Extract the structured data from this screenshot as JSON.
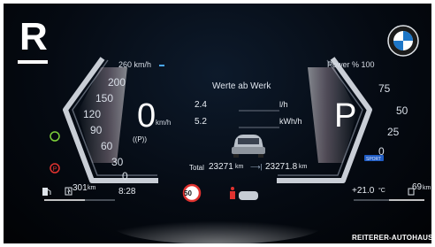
{
  "brand": {
    "logo_letter": "R",
    "website": "REITERER-AUTOHAUS.AT",
    "bmw_text": "BMW"
  },
  "speedometer": {
    "scale_unit": "260 km/h",
    "ticks": [
      "200",
      "150",
      "120",
      "90",
      "60",
      "30",
      "0"
    ],
    "speed": "0",
    "speed_unit": "km/h",
    "parking_brake": "((P))"
  },
  "power_gauge": {
    "label": "Power % 100",
    "ticks": [
      "75",
      "50",
      "25",
      "0"
    ],
    "gear": "P",
    "drive_mode": "SPORT"
  },
  "center": {
    "title": "Werte ab Werk",
    "consumption": [
      {
        "value": "2.4",
        "unit": "l/h"
      },
      {
        "value": "5.2",
        "unit": "kWh/h"
      }
    ],
    "total_label": "Total",
    "total_value": "23271",
    "total_unit": "km",
    "trip_value": "23271.8",
    "trip_unit": "km"
  },
  "status": {
    "range_value": "301",
    "range_unit": "km",
    "clock": "8:28",
    "speed_limit": "50",
    "outside_temp": "+21.0",
    "temp_unit": "°C",
    "electric_range": "69",
    "electric_unit": "km"
  },
  "colors": {
    "accent_blue": "#4aa8ff",
    "needle_pink": "#e8c8d8",
    "warning_red": "#e0322f",
    "green_indicator": "#7ccf3a"
  }
}
